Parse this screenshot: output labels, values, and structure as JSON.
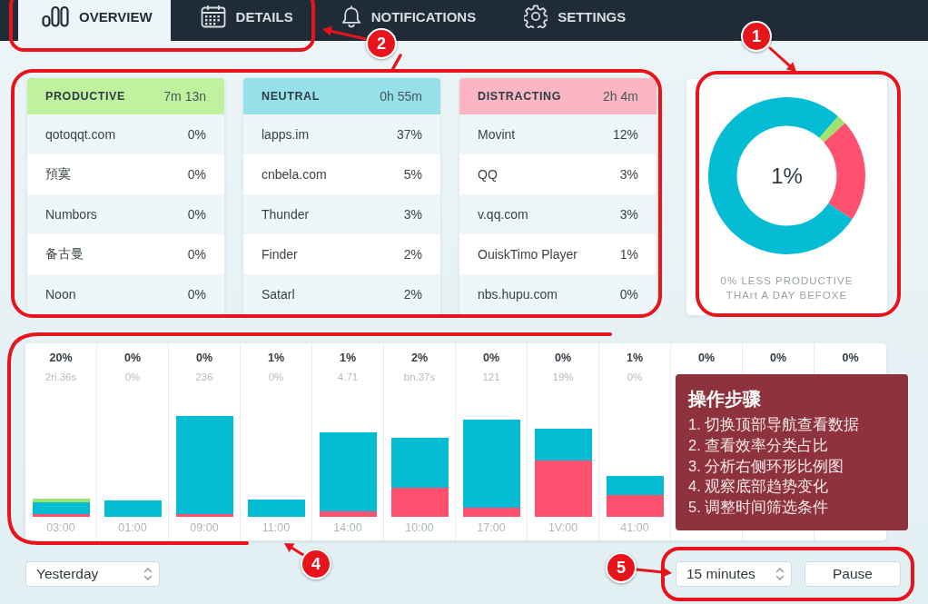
{
  "nav": {
    "tabs": [
      {
        "label": "OVERVIEW",
        "selected": true
      },
      {
        "label": "DETAILS",
        "selected": false
      },
      {
        "label": "NOTIFICATIONS",
        "selected": false
      },
      {
        "label": "SETTINGS",
        "selected": false
      }
    ]
  },
  "categories": [
    {
      "kind": "productive",
      "title": "PRODUCTIVE",
      "total": "7m 13n",
      "items": [
        {
          "name": "qotoqqt.com",
          "share": "0%"
        },
        {
          "name": "預寞",
          "share": "0%"
        },
        {
          "name": "Numbors",
          "share": "0%"
        },
        {
          "name": "备古曼",
          "share": "0%"
        },
        {
          "name": "Noon",
          "share": "0%"
        }
      ]
    },
    {
      "kind": "neutral",
      "title": "NEUTRAL",
      "total": "0h 55m",
      "items": [
        {
          "name": "lapps.im",
          "share": "37%"
        },
        {
          "name": "cnbela.com",
          "share": "5%"
        },
        {
          "name": "Thunder",
          "share": "3%"
        },
        {
          "name": "Finder",
          "share": "2%"
        },
        {
          "name": "Satarl",
          "share": "2%"
        }
      ]
    },
    {
      "kind": "distracting",
      "title": "DISTRACTING",
      "total": "2h 4m",
      "items": [
        {
          "name": "Movint",
          "share": "12%"
        },
        {
          "name": "QQ",
          "share": "3%"
        },
        {
          "name": "v.qq.com",
          "share": "3%"
        },
        {
          "name": "OuiskTimo Player",
          "share": "1%"
        },
        {
          "name": "nbs.hupu.com",
          "share": "0%"
        }
      ]
    }
  ],
  "summary": {
    "value": "1%",
    "caption": "0% LESS PRODUCTIVE\nTHArt A DAY BEFOXE",
    "chart_data": {
      "type": "donut",
      "values": [
        77,
        2,
        21
      ]
    }
  },
  "timeline": {
    "columns": [
      {
        "percent": "20%",
        "detail": "2ri.36s",
        "time": "03:00"
      },
      {
        "percent": "0%",
        "detail": "0%",
        "time": "01:00"
      },
      {
        "percent": "0%",
        "detail": "236",
        "time": "09:00"
      },
      {
        "percent": "1%",
        "detail": "0%",
        "time": "11:00"
      },
      {
        "percent": "1%",
        "detail": "4.71",
        "time": "14:00"
      },
      {
        "percent": "2%",
        "detail": "bn.37s",
        "time": "10:00"
      },
      {
        "percent": "0%",
        "detail": "121",
        "time": "17:00"
      },
      {
        "percent": "0%",
        "detail": "19%",
        "time": "1V:00"
      },
      {
        "percent": "1%",
        "detail": "0%",
        "time": "41:00"
      },
      {
        "percent": "0%"
      },
      {
        "percent": "0%"
      },
      {
        "percent": "0%"
      }
    ]
  },
  "steps_panel": {
    "title": "操作步骤",
    "steps": [
      "1. 切换顶部导航查看数据",
      "2. 查看效率分类占比",
      "3. 分析右侧环形比例图",
      "4. 观察底部趋势变化",
      "5. 调整时间筛选条件"
    ]
  },
  "controls": {
    "range": "Yesterday",
    "interval": "15 minutes",
    "pause": "Pause"
  },
  "annotations": [
    {
      "label": "1"
    },
    {
      "label": "2"
    },
    {
      "label": "4"
    },
    {
      "label": "5"
    }
  ]
}
